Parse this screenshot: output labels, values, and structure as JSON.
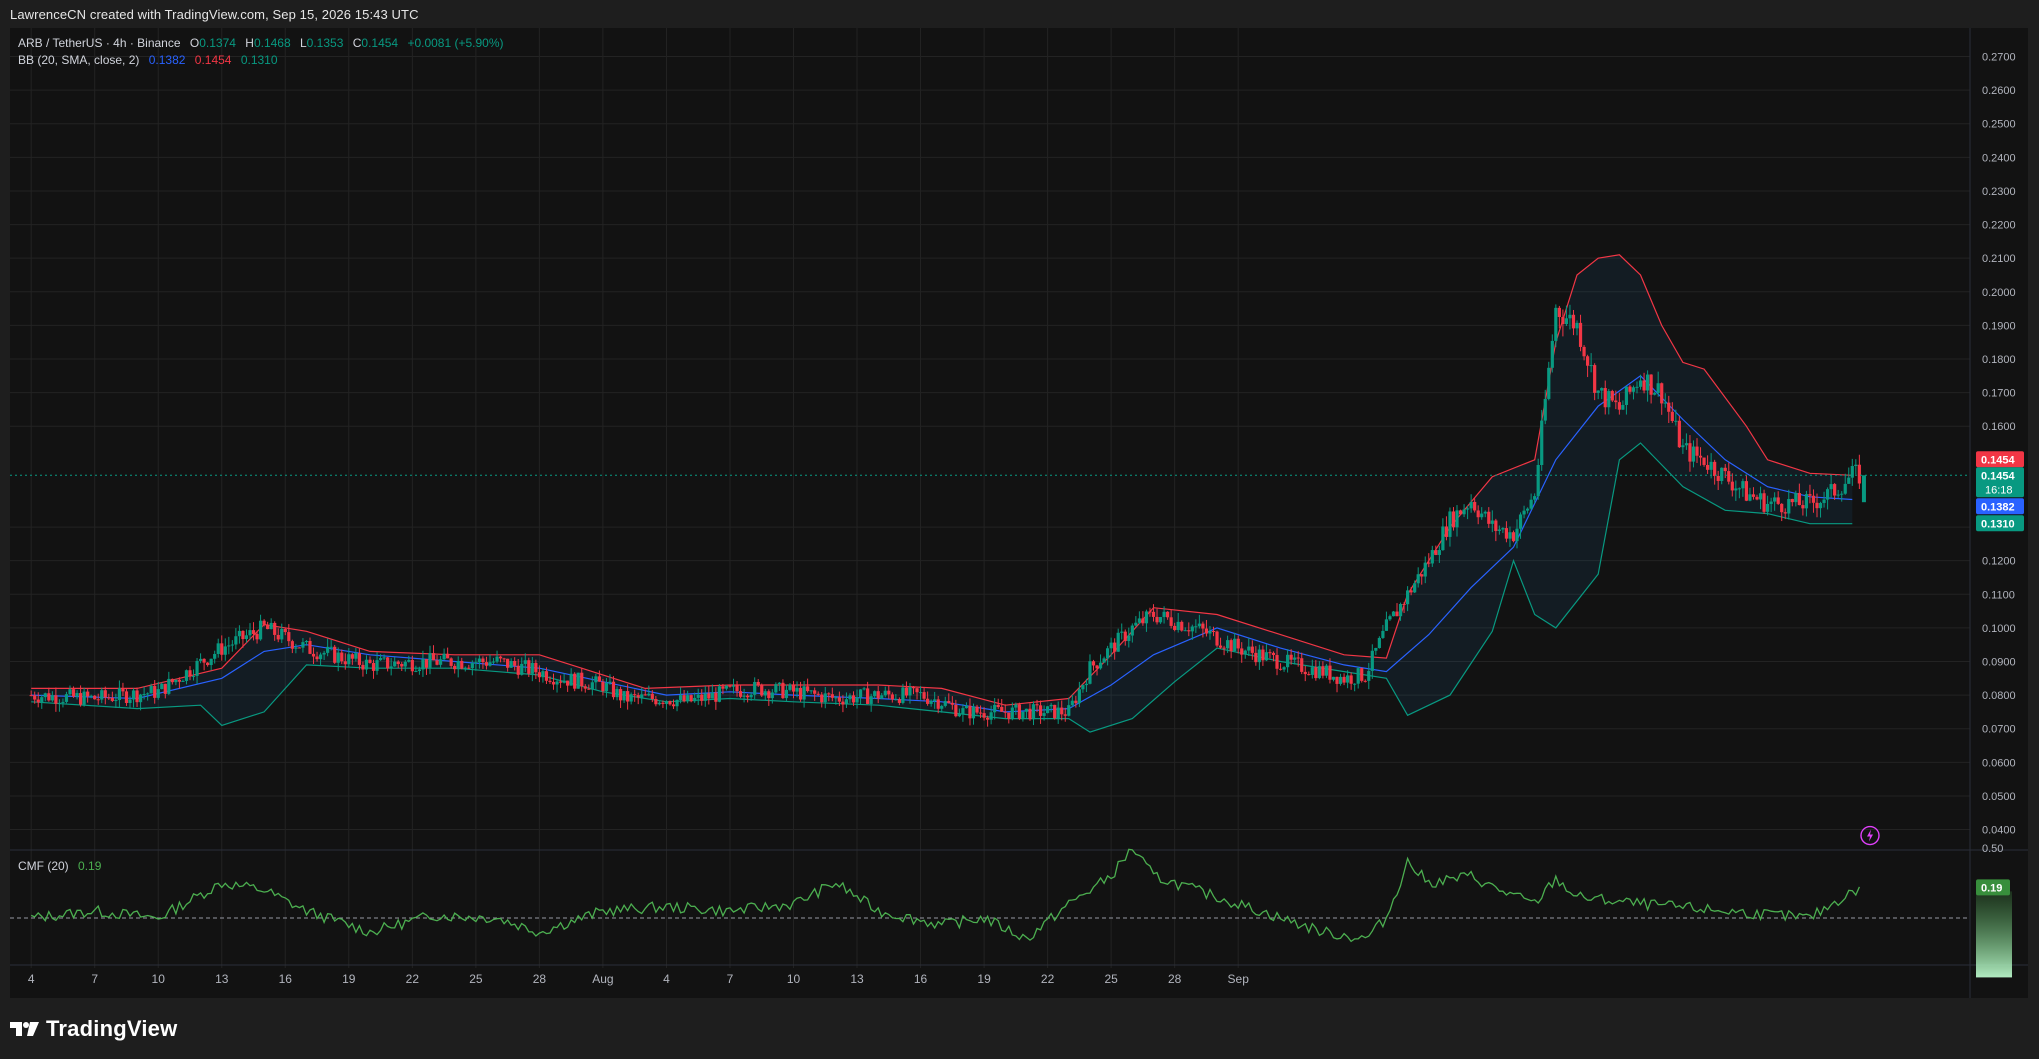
{
  "header": {
    "credit": "LawrenceCN created with TradingView.com, Sep 15, 2026 15:43 UTC"
  },
  "legend": {
    "symbol": "ARB / TetherUS · 4h · Binance",
    "o_label": "O",
    "o_value": "0.1374",
    "h_label": "H",
    "h_value": "0.1468",
    "l_label": "L",
    "l_value": "0.1353",
    "c_label": "C",
    "c_value": "0.1454",
    "change": "+0.0081 (+5.90%)",
    "bb_label": "BB (20, SMA, close, 2)",
    "bb_basis": "0.1382",
    "bb_upper": "0.1454",
    "bb_lower": "0.1310",
    "cmf_label": "CMF (20)",
    "cmf_value": "0.19"
  },
  "price_labels": {
    "upper": "0.1454",
    "last": "0.1454",
    "countdown": "16:18",
    "basis": "0.1382",
    "lower": "0.1310",
    "cmf": "0.19"
  },
  "branding": {
    "logo_text": "TradingView"
  },
  "colors": {
    "background": "#121212",
    "grid": "#232323",
    "up": "#089981",
    "down": "#f23645",
    "bb_upper": "#f23645",
    "bb_basis": "#2962ff",
    "bb_lower": "#089981",
    "bb_fill": "rgba(33,150,243,0.08)",
    "cmf": "#4caf50",
    "text": "#b2b5be"
  },
  "chart_data": [
    {
      "type": "candlestick",
      "title": "ARB / TetherUS · 4h · Binance",
      "x_tick_labels": [
        "4",
        "7",
        "10",
        "13",
        "16",
        "19",
        "22",
        "25",
        "28",
        "Aug",
        "4",
        "7",
        "10",
        "13",
        "16",
        "19",
        "22",
        "25",
        "28",
        "Sep"
      ],
      "y_tick_labels": [
        "0.2700",
        "0.2600",
        "0.2500",
        "0.2400",
        "0.2300",
        "0.2200",
        "0.2100",
        "0.2000",
        "0.1900",
        "0.1800",
        "0.1700",
        "0.1600",
        "0.1454",
        "0.1300",
        "0.1200",
        "0.1100",
        "0.1000",
        "0.0900",
        "0.0800",
        "0.0700",
        "0.0600",
        "0.0500",
        "0.0400"
      ],
      "ylim": [
        0.036,
        0.277
      ],
      "grid": true,
      "last_close": 0.1454,
      "series": [
        {
          "name": "Price (approx. close path, day index)",
          "points": [
            [
              0,
              0.08
            ],
            [
              3,
              0.079
            ],
            [
              6,
              0.081
            ],
            [
              9,
              0.094
            ],
            [
              11,
              0.1
            ],
            [
              12,
              0.097
            ],
            [
              13,
              0.094
            ],
            [
              16,
              0.089
            ],
            [
              19,
              0.09
            ],
            [
              22,
              0.09
            ],
            [
              24,
              0.087
            ],
            [
              25,
              0.085
            ],
            [
              27,
              0.083
            ],
            [
              28,
              0.079
            ],
            [
              30,
              0.079
            ],
            [
              31,
              0.078
            ],
            [
              33,
              0.081
            ],
            [
              34,
              0.082
            ],
            [
              36,
              0.081
            ],
            [
              38,
              0.079
            ],
            [
              40,
              0.08
            ],
            [
              42,
              0.08
            ],
            [
              43,
              0.078
            ],
            [
              44,
              0.075
            ],
            [
              46,
              0.075
            ],
            [
              48,
              0.075
            ],
            [
              49,
              0.075
            ],
            [
              50,
              0.088
            ],
            [
              52,
              0.1
            ],
            [
              53,
              0.104
            ],
            [
              55,
              0.1
            ],
            [
              57,
              0.094
            ],
            [
              59,
              0.09
            ],
            [
              61,
              0.087
            ],
            [
              62,
              0.085
            ],
            [
              63,
              0.086
            ],
            [
              64,
              0.1
            ],
            [
              65,
              0.11
            ],
            [
              66,
              0.12
            ],
            [
              67,
              0.132
            ],
            [
              68,
              0.138
            ],
            [
              69,
              0.13
            ],
            [
              70,
              0.128
            ],
            [
              71,
              0.14
            ],
            [
              72,
              0.195
            ],
            [
              73,
              0.19
            ],
            [
              74,
              0.17
            ],
            [
              75,
              0.165
            ],
            [
              76,
              0.175
            ],
            [
              77,
              0.17
            ],
            [
              78,
              0.153
            ],
            [
              79,
              0.15
            ],
            [
              80,
              0.145
            ],
            [
              81,
              0.14
            ],
            [
              82,
              0.137
            ],
            [
              84,
              0.137
            ],
            [
              85,
              0.14
            ],
            [
              86,
              0.1454
            ]
          ]
        },
        {
          "name": "BB upper",
          "points": [
            [
              0,
              0.082
            ],
            [
              5,
              0.082
            ],
            [
              9,
              0.088
            ],
            [
              11,
              0.101
            ],
            [
              13,
              0.099
            ],
            [
              16,
              0.093
            ],
            [
              20,
              0.092
            ],
            [
              24,
              0.092
            ],
            [
              26,
              0.088
            ],
            [
              29,
              0.082
            ],
            [
              33,
              0.083
            ],
            [
              36,
              0.083
            ],
            [
              40,
              0.083
            ],
            [
              43,
              0.082
            ],
            [
              46,
              0.077
            ],
            [
              49,
              0.079
            ],
            [
              51,
              0.092
            ],
            [
              53,
              0.106
            ],
            [
              56,
              0.104
            ],
            [
              59,
              0.098
            ],
            [
              62,
              0.092
            ],
            [
              64,
              0.091
            ],
            [
              65,
              0.11
            ],
            [
              67,
              0.13
            ],
            [
              69,
              0.145
            ],
            [
              71,
              0.15
            ],
            [
              72,
              0.185
            ],
            [
              73,
              0.205
            ],
            [
              74,
              0.21
            ],
            [
              75,
              0.211
            ],
            [
              76,
              0.205
            ],
            [
              77,
              0.19
            ],
            [
              78,
              0.179
            ],
            [
              79,
              0.177
            ],
            [
              81,
              0.16
            ],
            [
              82,
              0.15
            ],
            [
              84,
              0.146
            ],
            [
              86,
              0.1454
            ]
          ]
        },
        {
          "name": "BB basis",
          "points": [
            [
              0,
              0.08
            ],
            [
              5,
              0.079
            ],
            [
              9,
              0.085
            ],
            [
              11,
              0.093
            ],
            [
              13,
              0.095
            ],
            [
              16,
              0.092
            ],
            [
              20,
              0.09
            ],
            [
              24,
              0.088
            ],
            [
              27,
              0.084
            ],
            [
              30,
              0.08
            ],
            [
              33,
              0.081
            ],
            [
              36,
              0.08
            ],
            [
              40,
              0.079
            ],
            [
              43,
              0.078
            ],
            [
              46,
              0.075
            ],
            [
              49,
              0.076
            ],
            [
              51,
              0.083
            ],
            [
              53,
              0.092
            ],
            [
              56,
              0.1
            ],
            [
              59,
              0.094
            ],
            [
              62,
              0.089
            ],
            [
              64,
              0.087
            ],
            [
              66,
              0.098
            ],
            [
              68,
              0.112
            ],
            [
              70,
              0.124
            ],
            [
              72,
              0.15
            ],
            [
              74,
              0.166
            ],
            [
              76,
              0.175
            ],
            [
              78,
              0.162
            ],
            [
              80,
              0.15
            ],
            [
              82,
              0.142
            ],
            [
              84,
              0.139
            ],
            [
              86,
              0.1382
            ]
          ]
        },
        {
          "name": "BB lower",
          "points": [
            [
              0,
              0.078
            ],
            [
              5,
              0.076
            ],
            [
              8,
              0.077
            ],
            [
              9,
              0.071
            ],
            [
              11,
              0.075
            ],
            [
              13,
              0.089
            ],
            [
              16,
              0.088
            ],
            [
              20,
              0.088
            ],
            [
              24,
              0.086
            ],
            [
              27,
              0.081
            ],
            [
              30,
              0.078
            ],
            [
              33,
              0.079
            ],
            [
              36,
              0.078
            ],
            [
              40,
              0.077
            ],
            [
              43,
              0.075
            ],
            [
              46,
              0.073
            ],
            [
              49,
              0.073
            ],
            [
              50,
              0.069
            ],
            [
              52,
              0.073
            ],
            [
              54,
              0.084
            ],
            [
              56,
              0.094
            ],
            [
              59,
              0.09
            ],
            [
              62,
              0.087
            ],
            [
              64,
              0.085
            ],
            [
              65,
              0.074
            ],
            [
              67,
              0.08
            ],
            [
              69,
              0.099
            ],
            [
              70,
              0.12
            ],
            [
              71,
              0.104
            ],
            [
              72,
              0.1
            ],
            [
              74,
              0.116
            ],
            [
              75,
              0.15
            ],
            [
              76,
              0.155
            ],
            [
              78,
              0.142
            ],
            [
              80,
              0.135
            ],
            [
              82,
              0.134
            ],
            [
              84,
              0.131
            ],
            [
              86,
              0.131
            ]
          ]
        }
      ]
    },
    {
      "type": "line",
      "title": "CMF (20)",
      "y_tick_labels": [
        "0.50"
      ],
      "reference_line": 0,
      "last_value": 0.19,
      "series": [
        {
          "name": "CMF (20)",
          "points": [
            [
              0,
              0.0
            ],
            [
              3,
              0.05
            ],
            [
              6,
              0.0
            ],
            [
              9,
              0.25
            ],
            [
              11,
              0.2
            ],
            [
              13,
              0.05
            ],
            [
              16,
              -0.1
            ],
            [
              19,
              0.02
            ],
            [
              22,
              0.0
            ],
            [
              24,
              -0.1
            ],
            [
              27,
              0.05
            ],
            [
              30,
              0.08
            ],
            [
              33,
              0.05
            ],
            [
              36,
              0.1
            ],
            [
              38,
              0.25
            ],
            [
              40,
              0.05
            ],
            [
              43,
              -0.05
            ],
            [
              45,
              0.0
            ],
            [
              47,
              -0.15
            ],
            [
              49,
              0.1
            ],
            [
              51,
              0.3
            ],
            [
              52,
              0.5
            ],
            [
              53,
              0.3
            ],
            [
              55,
              0.2
            ],
            [
              57,
              0.1
            ],
            [
              59,
              0.0
            ],
            [
              61,
              -0.1
            ],
            [
              63,
              -0.15
            ],
            [
              64,
              0.0
            ],
            [
              65,
              0.4
            ],
            [
              66,
              0.25
            ],
            [
              68,
              0.3
            ],
            [
              69,
              0.22
            ],
            [
              71,
              0.1
            ],
            [
              72,
              0.28
            ],
            [
              73,
              0.15
            ],
            [
              76,
              0.1
            ],
            [
              80,
              0.05
            ],
            [
              84,
              0.0
            ],
            [
              86,
              0.19
            ]
          ]
        }
      ]
    }
  ]
}
